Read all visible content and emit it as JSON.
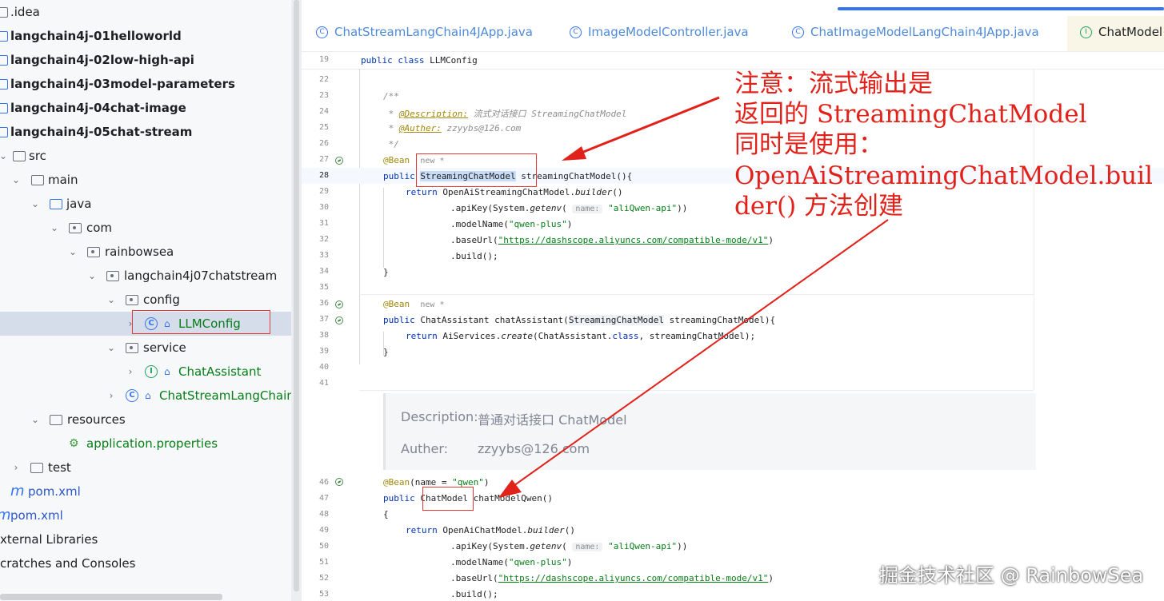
{
  "project_tree": {
    "items": [
      {
        "label": ".idea",
        "icon": "folder-icon",
        "style": "normal"
      },
      {
        "label": "langchain4j-01helloworld",
        "icon": "module-icon",
        "style": "bold"
      },
      {
        "label": "langchain4j-02low-high-api",
        "icon": "module-icon",
        "style": "bold"
      },
      {
        "label": "langchain4j-03model-parameters",
        "icon": "module-icon",
        "style": "bold"
      },
      {
        "label": "langchain4j-04chat-image",
        "icon": "module-icon",
        "style": "bold"
      },
      {
        "label": "langchain4j-05chat-stream",
        "icon": "module-icon",
        "style": "bold"
      },
      {
        "label": "src",
        "icon": "folder-icon"
      },
      {
        "label": "main",
        "icon": "folder-icon"
      },
      {
        "label": "java",
        "icon": "source-folder-icon"
      },
      {
        "label": "com",
        "icon": "package-icon"
      },
      {
        "label": "rainbowsea",
        "icon": "package-icon"
      },
      {
        "label": "langchain4j07chatstream",
        "icon": "package-icon"
      },
      {
        "label": "config",
        "icon": "package-icon"
      },
      {
        "label": "LLMConfig",
        "icon": "class-icon"
      },
      {
        "label": "service",
        "icon": "package-icon"
      },
      {
        "label": "ChatAssistant",
        "icon": "interface-icon"
      },
      {
        "label": "ChatStreamLangChain4J",
        "icon": "spring-boot-class-icon"
      },
      {
        "label": "resources",
        "icon": "resources-folder-icon"
      },
      {
        "label": "application.properties",
        "icon": "spring-properties-icon"
      },
      {
        "label": "test",
        "icon": "folder-icon"
      },
      {
        "label": "pom.xml",
        "icon": "maven-icon"
      },
      {
        "label": "pom.xml",
        "icon": "maven-icon"
      },
      {
        "label": "xternal Libraries",
        "icon": "library-icon"
      },
      {
        "label": "cratches and Consoles",
        "icon": "scratches-icon"
      }
    ]
  },
  "tabs": [
    {
      "label": "ChatStreamLangChain4JApp.java",
      "icon": "spring-boot-class-icon"
    },
    {
      "label": "ImageModelController.java",
      "icon": "class-icon"
    },
    {
      "label": "ChatImageModelLangChain4JApp.java",
      "icon": "spring-boot-class-icon"
    },
    {
      "label": "ChatModel",
      "icon": "interface-icon"
    }
  ],
  "editor": {
    "line_numbers": [
      "19",
      "22",
      "23",
      "24",
      "25",
      "26",
      "27",
      "28",
      "29",
      "30",
      "31",
      "32",
      "33",
      "34",
      "35",
      "36",
      "37",
      "38",
      "39",
      "40",
      "41",
      "46",
      "47",
      "48",
      "49",
      "50",
      "51",
      "52",
      "53"
    ],
    "code": {
      "l19_kw": "public class",
      "l19_rest": " LLMConfig",
      "l23": "/**",
      "l24_pre": " * ",
      "l24_tag": "@Description:",
      "l24_text": " 流式对话接口 StreamingChatModel",
      "l25_pre": " * ",
      "l25_tag": "@Auther:",
      "l25_text": " zzyybs@126.com",
      "l26": " */",
      "l27_ann": "@Bean",
      "new_hint": "new *",
      "l28_kw": "public",
      "l28_type": "StreamingChatModel",
      "l28_rest": " streamingChatModel(){",
      "l29_kw": "return",
      "l29_rest": " OpenAiStreamingChatModel.",
      "l29_method": "builder",
      "l29_end": "()",
      "apikey_pre": ".apiKey(System.",
      "apikey_method": "getenv",
      "apikey_open": "(",
      "name_hint": "name:",
      "apikey_str": "\"aliQwen-api\"",
      "apikey_end": "))",
      "modelname_pre": ".modelName(",
      "modelname_str": "\"qwen-plus\"",
      "modelname_end": ")",
      "baseurl_pre": ".baseUrl(",
      "baseurl_str": "\"https://dashscope.aliyuncs.com/compatible-mode/v1\"",
      "baseurl_end": ")",
      "build": ".build();",
      "close_brace": "}",
      "l37_kw": "public",
      "l37_rest": " ChatAssistant chatAssistant(",
      "l37_type": "StreamingChatModel",
      "l37_end": " streamingChatModel){",
      "l38_kw": "return",
      "l38_a": " AiServices.",
      "l38_method": "create",
      "l38_b": "(ChatAssistant.",
      "l38_kw2": "class",
      "l38_c": ", streamingChatModel);",
      "l46_ann": "@Bean",
      "l46_a": "(name = ",
      "l46_str": "\"qwen\"",
      "l46_b": ")",
      "l47_kw": "public",
      "l47_type": "ChatModel",
      "l47_rest": " chatModelQwen()",
      "l48": "{",
      "l49_kw": "return",
      "l49_rest": " OpenAiChatModel.",
      "l49_method": "builder",
      "l49_end": "()"
    },
    "doc_popup": {
      "desc_label": "Description:",
      "desc_value": "普通对话接口 ChatModel",
      "auth_label": "Auther:",
      "auth_value": "zzyybs@126.com"
    }
  },
  "annotation": {
    "lines": [
      "注意：流式输出是",
      "返回的 StreamingChatModel",
      "同时是使用：",
      "OpenAiStreamingChatModel.buil",
      "der() 方法创建"
    ],
    "color": "#e0221b"
  },
  "watermark": "掘金技术社区 @ RainbowSea"
}
